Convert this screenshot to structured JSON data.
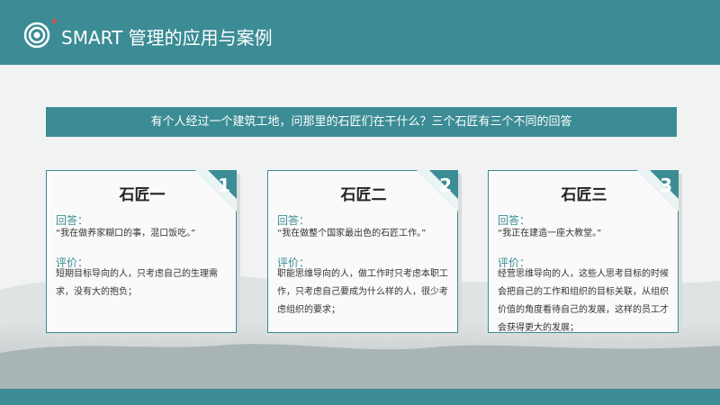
{
  "header": {
    "title": "SMART 管理的应用与案例",
    "logo_icon": "target-icon"
  },
  "banner": {
    "text": "有个人经过一个建筑工地，问那里的石匠们在干什么？三个石匠有三个不同的回答"
  },
  "colors": {
    "accent": "#3b8c95",
    "header_bg": "#3b8c95",
    "dot": "#e05050"
  },
  "cards": [
    {
      "number": "1",
      "title": "石匠一",
      "answer_label": "回答：",
      "answer": "“我在做养家糊口的事，混口饭吃。”",
      "review_label": "评价：",
      "review": "短期目标导向的人，只考虑自己的生理需求，没有大的抱负；"
    },
    {
      "number": "2",
      "title": "石匠二",
      "answer_label": "回答：",
      "answer": "“我在做整个国家最出色的石匠工作。”",
      "review_label": "评价：",
      "review": "职能思维导向的人，做工作时只考虑本职工作，只考虑自己要成为什么样的人，很少考虑组织的要求；"
    },
    {
      "number": "3",
      "title": "石匠三",
      "answer_label": "回答：",
      "answer": "“我正在建造一座大教堂。”",
      "review_label": "评价：",
      "review": "经营思维导向的人，这些人思考目标的时候会把自己的工作和组织的目标关联，从组织价值的角度看待自己的发展，这样的员工才会获得更大的发展；"
    }
  ]
}
